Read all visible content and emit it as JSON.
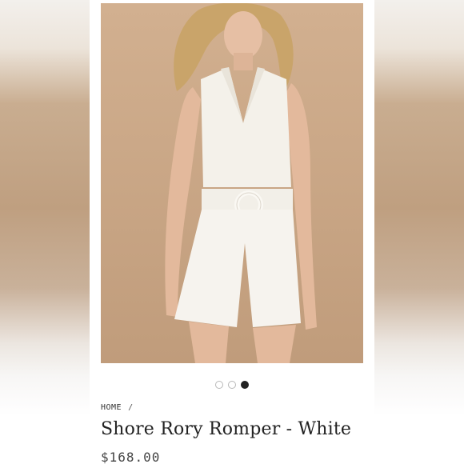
{
  "gallery": {
    "image_alt": "Model wearing white halter romper with belt",
    "slide_count": 3,
    "active_slide": 3
  },
  "breadcrumb": {
    "home_label": "HOME",
    "separator": "/"
  },
  "product": {
    "title": "Shore Rory Romper - White",
    "price": "$168.00"
  },
  "colors": {
    "backdrop": "#c8a585",
    "garment": "#f4f1ea",
    "text": "#222222"
  }
}
